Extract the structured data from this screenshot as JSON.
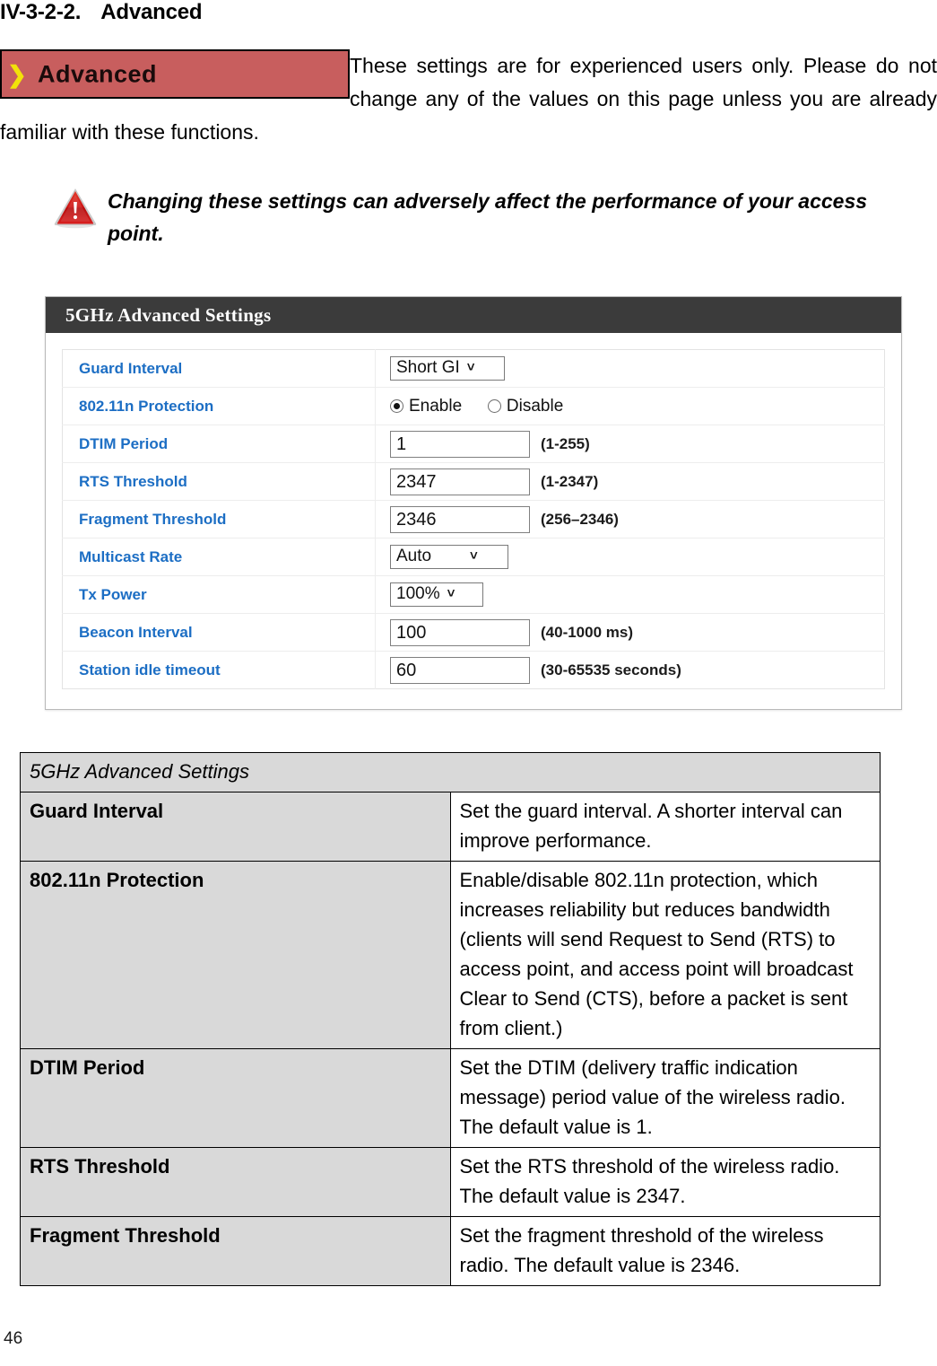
{
  "heading": {
    "number": "IV-3-2-2.",
    "title": "Advanced"
  },
  "banner": {
    "label": "Advanced",
    "chevron_icon": "chevron-right-icon",
    "bg_color": "#c85e5e",
    "chevron_color": "#f2e20a"
  },
  "intro": {
    "line1": "These settings are for experienced users only.",
    "line2": "Please do not change any of the values on this",
    "line3": "page unless you are already familiar with these functions."
  },
  "warning": {
    "icon": "warning-triangle-icon",
    "text": "Changing these settings can adversely affect the performance of your access point."
  },
  "panel": {
    "header": "5GHz Advanced Settings",
    "header_bg": "#3b3b3b",
    "label_color": "#1c6ec4",
    "rows": [
      {
        "label": "Guard Interval",
        "type": "select",
        "value": "Short GI",
        "hint": ""
      },
      {
        "label": "802.11n Protection",
        "type": "radio",
        "options": [
          "Enable",
          "Disable"
        ],
        "selected": "Enable",
        "hint": ""
      },
      {
        "label": "DTIM Period",
        "type": "input",
        "value": "1",
        "hint": "(1-255)"
      },
      {
        "label": "RTS Threshold",
        "type": "input",
        "value": "2347",
        "hint": "(1-2347)"
      },
      {
        "label": "Fragment Threshold",
        "type": "input",
        "value": "2346",
        "hint": "(256–2346)"
      },
      {
        "label": "Multicast Rate",
        "type": "select",
        "value": "Auto",
        "hint": ""
      },
      {
        "label": "Tx Power",
        "type": "select",
        "value": "100%",
        "hint": ""
      },
      {
        "label": "Beacon Interval",
        "type": "input",
        "value": "100",
        "hint": "(40-1000 ms)"
      },
      {
        "label": "Station idle timeout",
        "type": "input",
        "value": "60",
        "hint": "(30-65535 seconds)"
      }
    ]
  },
  "description_table": {
    "title": "5GHz Advanced Settings",
    "rows": [
      {
        "key": "Guard Interval",
        "value": "Set the guard interval. A shorter interval can improve performance."
      },
      {
        "key": "802.11n Protection",
        "value": "Enable/disable 802.11n protection, which increases reliability but reduces bandwidth (clients will send Request to Send (RTS) to access point, and access point will broadcast Clear to Send (CTS), before a packet is sent from client.)"
      },
      {
        "key": "DTIM Period",
        "value": "Set the DTIM (delivery traffic indication message) period value of the wireless radio. The default value is 1."
      },
      {
        "key": "RTS Threshold",
        "value": "Set the RTS threshold of the wireless radio. The default value is 2347."
      },
      {
        "key": "Fragment Threshold",
        "value": "Set the fragment threshold of the wireless radio. The default value is 2346."
      }
    ]
  },
  "page_number": "46"
}
